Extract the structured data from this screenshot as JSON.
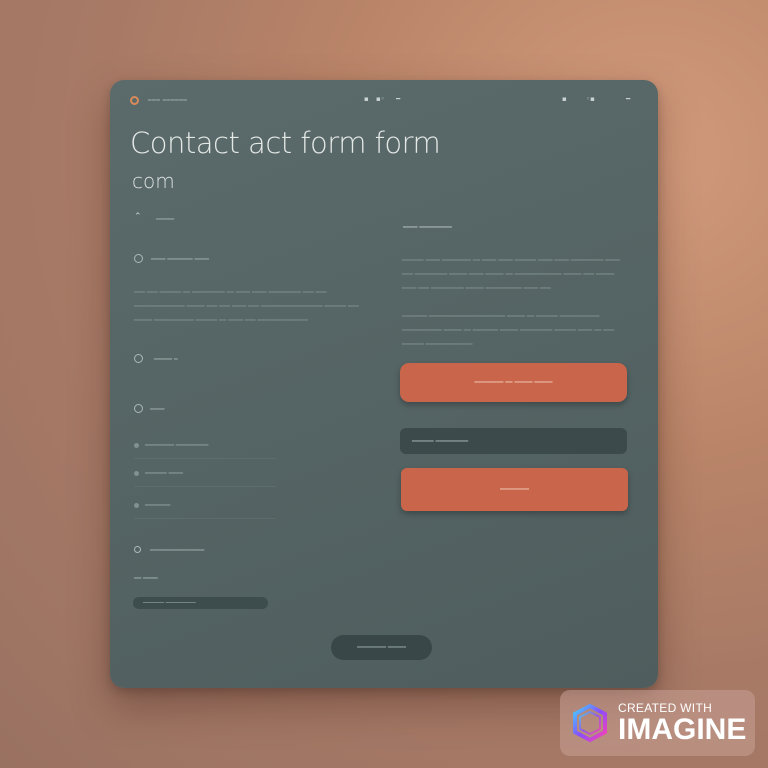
{
  "header": {
    "brand": "━━━ ━━━━━━",
    "nav_left_1": "▪",
    "nav_left_2": "▪◦",
    "nav_left_3": "━",
    "nav_right_1": "▪",
    "nav_right_2": "◦▪",
    "nav_right_3": "━"
  },
  "title": "Contact act form form",
  "subtitle": "com",
  "left": {
    "top_label": "━━━━━",
    "item1": "━━━━ ━━━━━━━ ━━━━",
    "paragraph": "━━━ ━━━ ━━━━━━ ━━ ━━━━━━━━━ ━━ ━━━━ ━━━━ ━━━━━━━━━ ━━━ ━━━ ━━━━━━━━━━━━━━ ━━━━━ ━━━ ━━━ ━━━━ ━━━ ━━━━━━━━━━━━━━━━━ ━━━━━━ ━━━ ━━━━━ ━━━━━━━━━━━ ━━━━━━ ━━ ━━━━ ━━━ ━━━━━━━━━━━━━━",
    "item2": "━━━━━ ━",
    "item3": "━━━━",
    "fields": [
      {
        "label": "━━━━━━━━ ━━━━━━━━━"
      },
      {
        "label": "━━━━━━ ━━━━"
      },
      {
        "label": "━━━━━━━"
      }
    ],
    "item4": "━━━━━━━━━━━━━━━",
    "item5": "━━ ━━━━",
    "input_placeholder": "━━━━━━━ ━━━━━━━━━━"
  },
  "right": {
    "heading": "━━━━ ━━━━━━━━━",
    "paragraph1": "━━━━━━ ━━━━ ━━━━━━━━ ━━ ━━━━ ━━━━ ━━━━━━ ━━━━ ━━━━ ━━━━━━━━━ ━━━━ ━━━ ━━━━━━━━━ ━━━━━ ━━━━ ━━━━━ ━━ ━━━━━━━━━━━━━ ━━━━━ ━━━ ━━━━━ ━━━━ ━━━ ━━━━━━━━━ ━━━━━ ━━━━━━━━━━ ━━━━ ━━━",
    "paragraph2": "━━━━━━━ ━━━━━━━━━━━━━━━━━━━━━ ━━━━━ ━━ ━━━━━━ ━━━━━━━━━━━ ━━━━━━━━━━━ ━━━━━ ━━ ━━━━━━━ ━━━━━ ━━━━━━━━━ ━━━━━━ ━━━━ ━━ ━━━ ━━━━━━ ━━━━━━━━━━━━━",
    "primary_button": "━━━━━━━━ ━━ ━━━━━ ━━━━━",
    "input_value": "━━━━━━ ━━━━━━━━━",
    "secondary_button": "━━━━━━━━"
  },
  "bottom_button": "━━━━━━━━ ━━━━━",
  "watermark": {
    "small": "CREATED WITH",
    "big": "IMAGINE"
  },
  "colors": {
    "accent": "#c8654a",
    "card_bg": "#566565",
    "dark_field": "#3c4a4c"
  }
}
